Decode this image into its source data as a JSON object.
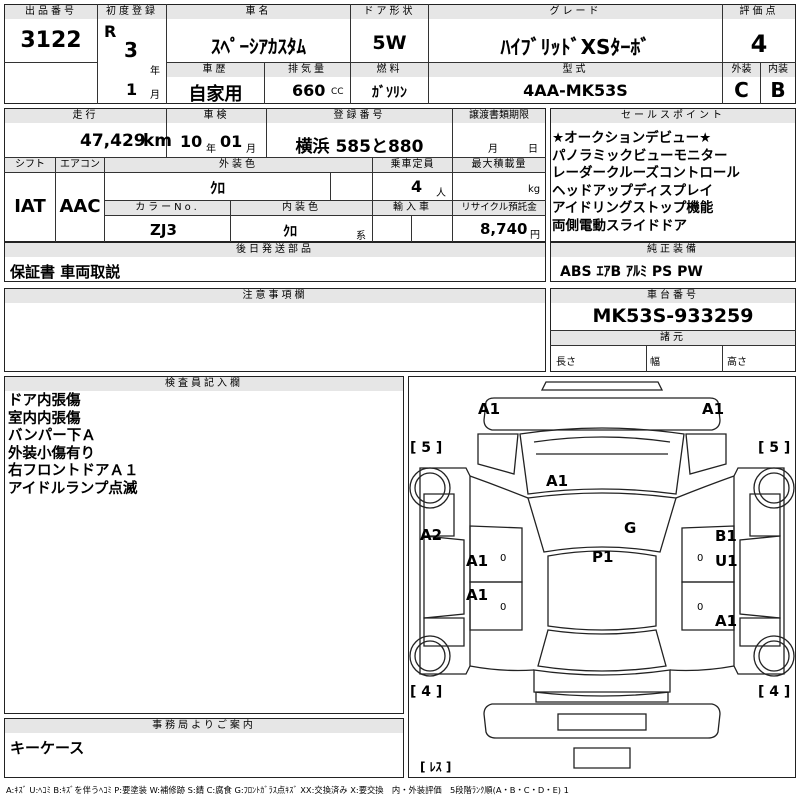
{
  "header": {
    "lot_label": "出品番号",
    "lot_value": "3122",
    "first_reg_label": "初度登録",
    "era_symbol": "R",
    "reg_year": "3",
    "year_unit": "年",
    "reg_month": "1",
    "month_unit": "月",
    "car_name_label": "車名",
    "car_name": "ｽﾍﾟｰｼｱｶｽﾀﾑ",
    "door_label": "ドア形状",
    "door_value": "5W",
    "grade_label": "グレード",
    "grade_value": "ﾊｲﾌﾞﾘｯﾄﾞXSﾀｰﾎﾞ",
    "score_label": "評価点",
    "score_value": "4",
    "history_label": "車歴",
    "history_value": "自家用",
    "displacement_label": "排気量",
    "displacement_value": "660",
    "displacement_unit": "CC",
    "fuel_label": "燃料",
    "fuel_value": "ｶﾞｿﾘﾝ",
    "model_label": "型式",
    "model_value": "4AA-MK53S",
    "exterior_label": "外装",
    "exterior_value": "C",
    "interior_label": "内装",
    "interior_value": "B"
  },
  "row2": {
    "mileage_label": "走行",
    "mileage_value": "47,429",
    "mileage_unit": "km",
    "inspection_label": "車検",
    "inspection_year": "10",
    "inspection_year_unit": "年",
    "inspection_month": "01",
    "inspection_month_unit": "月",
    "plate_label": "登録番号",
    "plate_value": "横浜 585と880",
    "transfer_label": "譲渡書類期限",
    "transfer_month_unit": "月",
    "transfer_day_unit": "日"
  },
  "row3": {
    "shift_label": "シフト",
    "shift_value": "IAT",
    "ac_label": "エアコン",
    "ac_value": "AAC",
    "ext_color_label": "外装色",
    "ext_color_value": "ｸﾛ",
    "capacity_label": "乗車定員",
    "capacity_value": "4",
    "capacity_unit": "人",
    "max_load_label": "最大積載量",
    "max_load_unit": "kg",
    "color_no_label": "カラーNo.",
    "color_no_value": "ZJ3",
    "int_color_label": "内装色",
    "int_color_value": "ｸﾛ",
    "int_color_suffix": "系",
    "import_label": "輸入車",
    "recycle_label": "リサイクル預託金",
    "recycle_value": "8,740",
    "recycle_unit": "円"
  },
  "sales_points": {
    "label": "セールスポイント",
    "items": [
      "★オークションデビュー★",
      "パノラミックビューモニター",
      "レーダークルーズコントロール",
      "ヘッドアップディスプレイ",
      "アイドリングストップ機能",
      "両側電動スライドドア"
    ]
  },
  "later_items": {
    "label": "後日発送部品",
    "value": "保証書 車両取説"
  },
  "equipment": {
    "label": "純正装備",
    "value": "ABS ｴｱB ｱﾙﾐ PS PW"
  },
  "notes": {
    "label": "注意事項欄"
  },
  "chassis": {
    "label": "車台番号",
    "value": "MK53S-933259",
    "specs_label": "諸元",
    "length_label": "長さ",
    "width_label": "幅",
    "height_label": "高さ"
  },
  "inspector": {
    "label": "検査員記入欄",
    "lines": [
      "ドア内張傷",
      "室内内張傷",
      "バンパー下Ａ",
      "外装小傷有り",
      "右フロントドアＡ１",
      "アイドルランプ点滅"
    ]
  },
  "office": {
    "label": "事務局よりご案内",
    "value": "キーケース"
  },
  "diagram": {
    "marks": {
      "top_left": "A1",
      "top_right": "A1",
      "hood": "A1",
      "left_side": "A2",
      "left_front_door": "A1",
      "left_rear_door": "A1",
      "roof": "P1",
      "right_g": "G",
      "right_b1": "B1",
      "right_u1": "U1",
      "right_rear_door": "A1"
    },
    "tire_front_left": "[ 5 ]",
    "tire_front_right": "[ 5 ]",
    "tire_rear_left": "[ 4 ]",
    "tire_rear_right": "[ 4 ]",
    "spare_tire": "[ ﾚｽ ]",
    "zero_mark": "0"
  },
  "legend": "A:ｷｽﾞ U:ﾍｺﾐ B:ｷｽﾞを伴うﾍｺﾐ P:要塗装 W:補修跡 S:錆 C:腐食 G:ﾌﾛﾝﾄｶﾞﾗｽ点ｷｽﾞ XX:交換済み X:要交換　内・外装評価　5段階ﾗﾝｸ順(A・B・C・D・E) 1"
}
